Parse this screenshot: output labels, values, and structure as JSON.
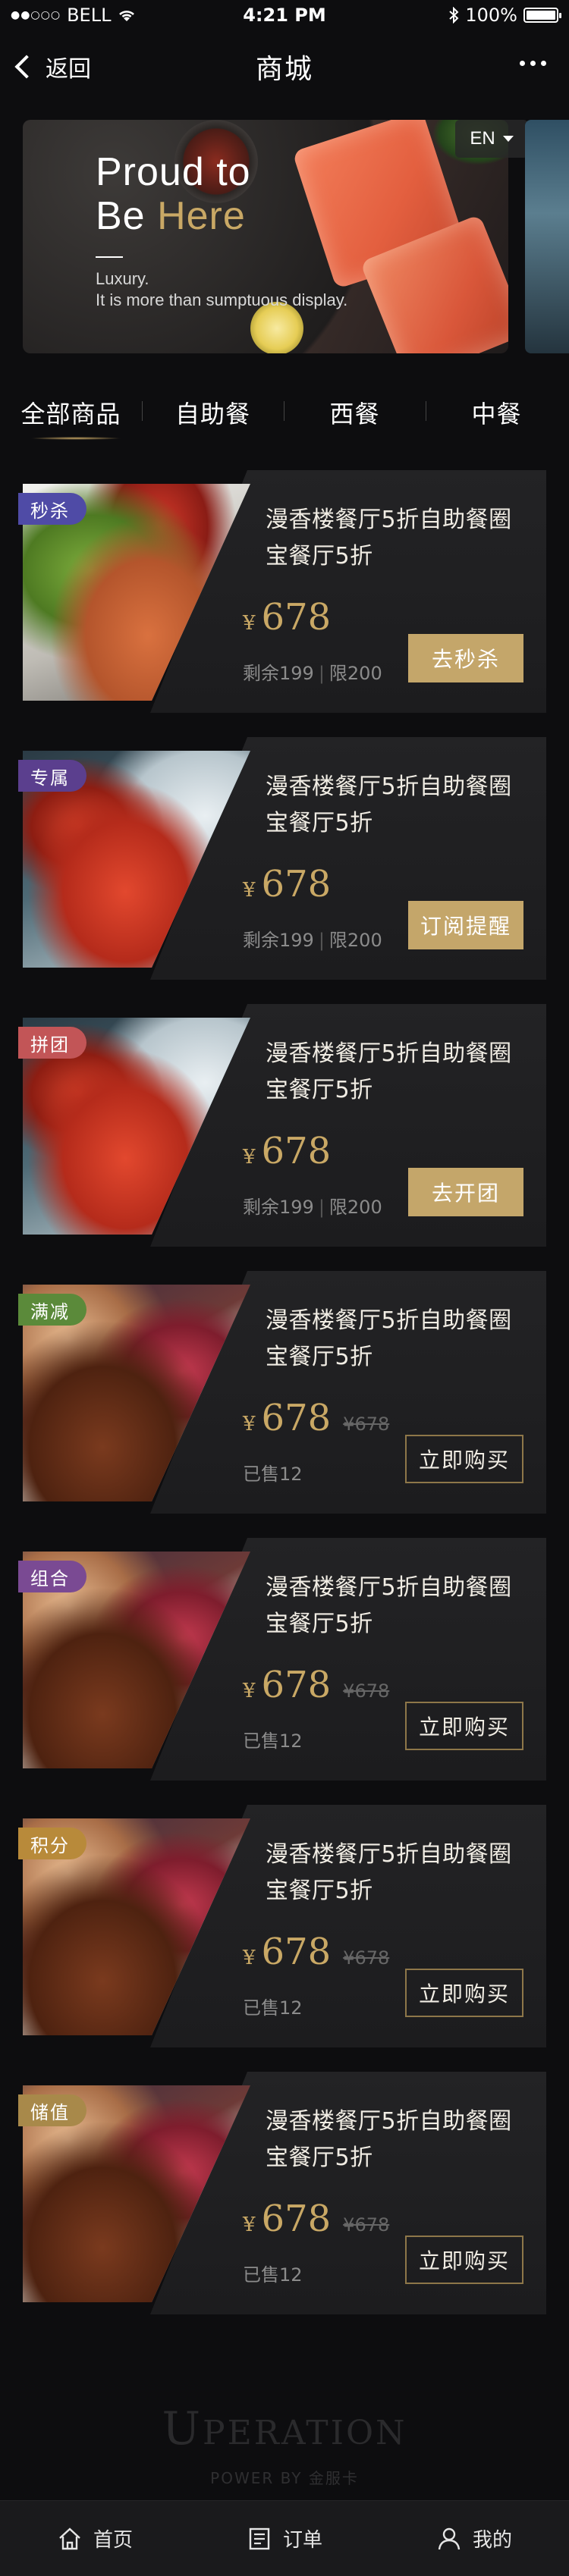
{
  "status_bar": {
    "carrier": "BELL",
    "time": "4:21 PM",
    "battery": "100%"
  },
  "nav": {
    "back_label": "返回",
    "title": "商城",
    "more_icon": "more-icon"
  },
  "banner": {
    "title_line1": "Proud to",
    "title_line2_prefix": "Be ",
    "title_line2_accent": "Here",
    "sub_line1": "Luxury.",
    "sub_line2": "It is more than sumptuous display.",
    "language": "EN"
  },
  "tabs": [
    {
      "label": "全部商品",
      "active": true
    },
    {
      "label": "自助餐",
      "active": false
    },
    {
      "label": "西餐",
      "active": false
    },
    {
      "label": "中餐",
      "active": false
    }
  ],
  "products": [
    {
      "badge": "秒杀",
      "badge_color": "#4f4ba6",
      "image": "salmon",
      "title": "漫香楼餐厅5折自助餐圈宝餐厅5折",
      "currency": "¥",
      "price": "678",
      "original_price": "",
      "stock_left": "剩余199",
      "stock_sep": "|",
      "stock_limit": "限200",
      "button": "去秒杀",
      "button_style": "solid"
    },
    {
      "badge": "专属",
      "badge_color": "#5b3f8e",
      "image": "crab",
      "title": "漫香楼餐厅5折自助餐圈宝餐厅5折",
      "currency": "¥",
      "price": "678",
      "original_price": "",
      "stock_left": "剩余199",
      "stock_sep": "|",
      "stock_limit": "限200",
      "button": "订阅提醒",
      "button_style": "solid"
    },
    {
      "badge": "拼团",
      "badge_color": "#c25557",
      "image": "crab",
      "title": "漫香楼餐厅5折自助餐圈宝餐厅5折",
      "currency": "¥",
      "price": "678",
      "original_price": "",
      "stock_left": "剩余199",
      "stock_sep": "|",
      "stock_limit": "限200",
      "button": "去开团",
      "button_style": "solid"
    },
    {
      "badge": "满减",
      "badge_color": "#5b8a3a",
      "image": "bbq",
      "title": "漫香楼餐厅5折自助餐圈宝餐厅5折",
      "currency": "¥",
      "price": "678",
      "original_price": "¥678",
      "stock_left": "已售12",
      "stock_sep": "",
      "stock_limit": "",
      "button": "立即购买",
      "button_style": "outline"
    },
    {
      "badge": "组合",
      "badge_color": "#7a4a93",
      "image": "bbq",
      "title": "漫香楼餐厅5折自助餐圈宝餐厅5折",
      "currency": "¥",
      "price": "678",
      "original_price": "¥678",
      "stock_left": "已售12",
      "stock_sep": "",
      "stock_limit": "",
      "button": "立即购买",
      "button_style": "outline"
    },
    {
      "badge": "积分",
      "badge_color": "#b88a3a",
      "image": "bbq",
      "title": "漫香楼餐厅5折自助餐圈宝餐厅5折",
      "currency": "¥",
      "price": "678",
      "original_price": "¥678",
      "stock_left": "已售12",
      "stock_sep": "",
      "stock_limit": "",
      "button": "立即购买",
      "button_style": "outline"
    },
    {
      "badge": "储值",
      "badge_color": "#a8894a",
      "image": "bbq",
      "title": "漫香楼餐厅5折自助餐圈宝餐厅5折",
      "currency": "¥",
      "price": "678",
      "original_price": "¥678",
      "stock_left": "已售12",
      "stock_sep": "",
      "stock_limit": "",
      "button": "立即购买",
      "button_style": "outline"
    }
  ],
  "footer": {
    "logo_first": "U",
    "logo_rest": "PERATION",
    "powered_by": "POWER BY 金服卡"
  },
  "tab_bar": [
    {
      "label": "首页",
      "icon": "home-icon"
    },
    {
      "label": "订单",
      "icon": "order-icon"
    },
    {
      "label": "我的",
      "icon": "profile-icon"
    }
  ]
}
